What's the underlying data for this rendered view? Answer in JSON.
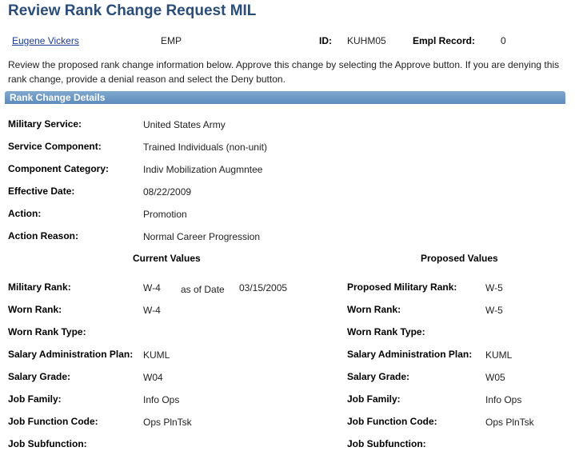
{
  "page": {
    "title": "Review Rank Change Request MIL"
  },
  "employee": {
    "name": "Eugene Vickers",
    "type": "EMP",
    "id_label": "ID:",
    "id_value": "KUHM05",
    "empl_record_label": "Empl Record:",
    "empl_record_value": "0"
  },
  "instructions": "Review the proposed rank change information below. Approve this change by selecting the Approve button. If you are denying this rank change, provide a denial reason and select the Deny button.",
  "section": {
    "title": "Rank Change Details"
  },
  "details": [
    {
      "label": "Military Service:",
      "value": "United States Army"
    },
    {
      "label": "Service Component:",
      "value": "Trained Individuals (non-unit)"
    },
    {
      "label": "Component Category:",
      "value": "Indiv Mobilization Augmntee"
    },
    {
      "label": "Effective Date:",
      "value": "08/22/2009"
    },
    {
      "label": "Action:",
      "value": "Promotion"
    },
    {
      "label": "Action Reason:",
      "value": "Normal Career Progression"
    }
  ],
  "columns": {
    "current": "Current Values",
    "proposed": "Proposed Values"
  },
  "as_of": {
    "label": "as of Date",
    "value": "03/15/2005"
  },
  "current": [
    {
      "label": "Military Rank:",
      "value": "W-4"
    },
    {
      "label": "Worn Rank:",
      "value": "W-4"
    },
    {
      "label": "Worn Rank Type:",
      "value": ""
    },
    {
      "label": "Salary Administration Plan:",
      "value": "KUML"
    },
    {
      "label": "Salary Grade:",
      "value": "W04"
    },
    {
      "label": "Job Family:",
      "value": "Info Ops"
    },
    {
      "label": "Job Function Code:",
      "value": "Ops PlnTsk"
    },
    {
      "label": "Job Subfunction:",
      "value": ""
    }
  ],
  "proposed": [
    {
      "label": "Proposed Military Rank:",
      "value": "W-5"
    },
    {
      "label": "Worn Rank:",
      "value": "W-5"
    },
    {
      "label": "Worn Rank Type:",
      "value": ""
    },
    {
      "label": "Salary Administration Plan:",
      "value": "KUML"
    },
    {
      "label": "Salary Grade:",
      "value": "W05"
    },
    {
      "label": "Job Family:",
      "value": "Info Ops"
    },
    {
      "label": "Job Function Code:",
      "value": "Ops PlnTsk"
    },
    {
      "label": "Job Subfunction:",
      "value": ""
    }
  ]
}
